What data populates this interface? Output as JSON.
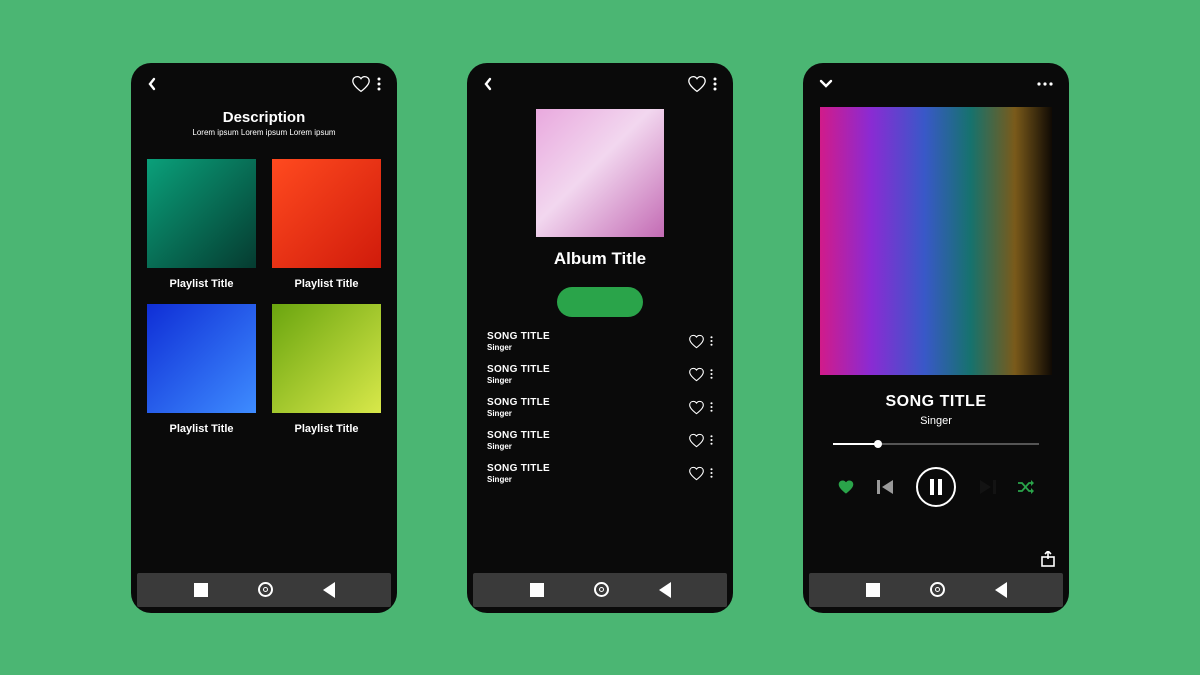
{
  "colors": {
    "accent": "#2aa44a",
    "bg": "#4bb673"
  },
  "screen1": {
    "heading": "Description",
    "subheading": "Lorem ipsum  Lorem ipsum  Lorem ipsum",
    "playlists": [
      {
        "title": "Playlist Title"
      },
      {
        "title": "Playlist Title"
      },
      {
        "title": "Playlist Title"
      },
      {
        "title": "Playlist Title"
      }
    ]
  },
  "screen2": {
    "album_title": "Album Title",
    "play_button_label": "",
    "songs": [
      {
        "title": "SONG TITLE",
        "singer": "Singer"
      },
      {
        "title": "SONG TITLE",
        "singer": "Singer"
      },
      {
        "title": "SONG TITLE",
        "singer": "Singer"
      },
      {
        "title": "SONG TITLE",
        "singer": "Singer"
      },
      {
        "title": "SONG TITLE",
        "singer": "Singer"
      }
    ]
  },
  "screen3": {
    "song_title": "SONG TITLE",
    "singer": "Singer",
    "progress_pct": 22,
    "liked": true,
    "playing": false,
    "shuffle_on": true
  }
}
